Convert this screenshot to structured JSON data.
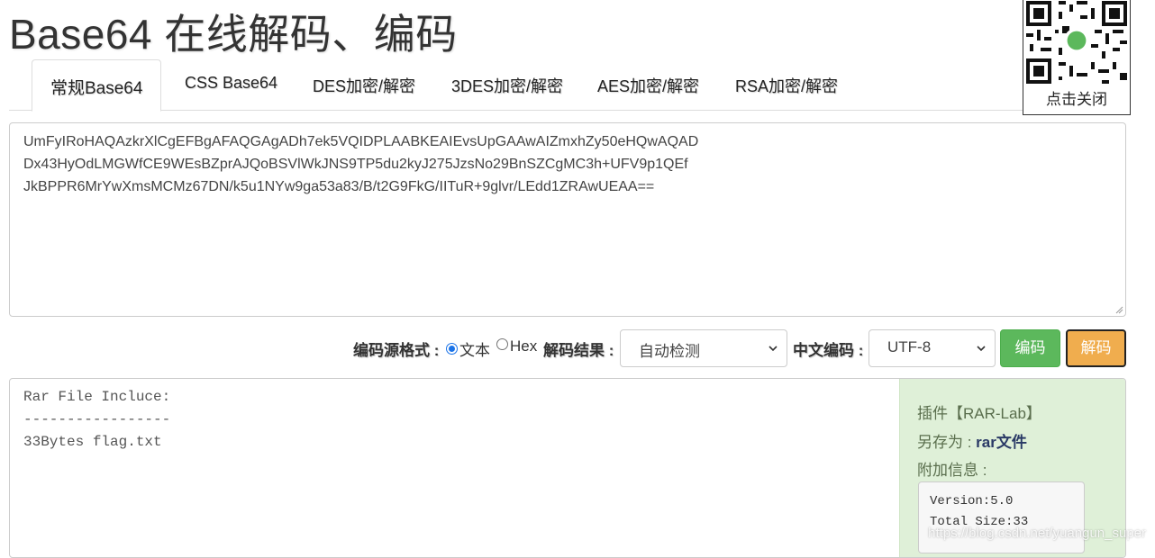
{
  "page": {
    "title": "Base64 在线解码、编码"
  },
  "tabs": [
    {
      "label": "常规Base64",
      "active": true
    },
    {
      "label": "CSS Base64",
      "active": false
    },
    {
      "label": "DES加密/解密",
      "active": false
    },
    {
      "label": "3DES加密/解密",
      "active": false
    },
    {
      "label": "AES加密/解密",
      "active": false
    },
    {
      "label": "RSA加密/解密",
      "active": false
    }
  ],
  "qr_popup": {
    "icon": "qr-code-icon",
    "close_label": "点击关闭"
  },
  "input": {
    "lines": [
      "UmFyIRoHAQAzkrXlCgEFBgAFAQGAgADh7ek5VQIDPLAABKEAIEvsUpGAAwAIZmxhZy50eHQwAQAD",
      "Dx43HyOdLMGWfCE9WEsBZprAJQoBSVlWkJNS9TP5du2kyJ275JzsNo29BnSZCgMC3h+UFV9p1QEf",
      "JkBPPR6MrYwXmsMCMz67DN/k5u1NYw9ga53a83/B/t2G9FkG/IITuR+9glvr/LEdd1ZRAwUEAA=="
    ]
  },
  "controls": {
    "source_format_label": "编码源格式 :",
    "radio_text": {
      "label": "文本",
      "checked": true
    },
    "radio_hex": {
      "label": "Hex",
      "checked": false
    },
    "result_label": "解码结果 :",
    "result_select": "自动检测",
    "charset_label": "中文编码 :",
    "charset_select": "UTF-8",
    "encode_button": "编码",
    "decode_button": "解码"
  },
  "output": {
    "lines": [
      "Rar File Incluce:",
      "-----------------",
      "33Bytes flag.txt"
    ]
  },
  "plugin": {
    "name": "插件【RAR-Lab】",
    "save_as_label": "另存为 : ",
    "save_as_value": "rar文件",
    "extra_label": "附加信息 :",
    "version": "Version:5.0",
    "total_size": "Total Size:33"
  },
  "watermark": "https://blog.csdn.net/yuangun_super",
  "colors": {
    "encode": "#5cb85c",
    "decode": "#f0ad4e",
    "plugin_bg": "#dff0d8"
  }
}
